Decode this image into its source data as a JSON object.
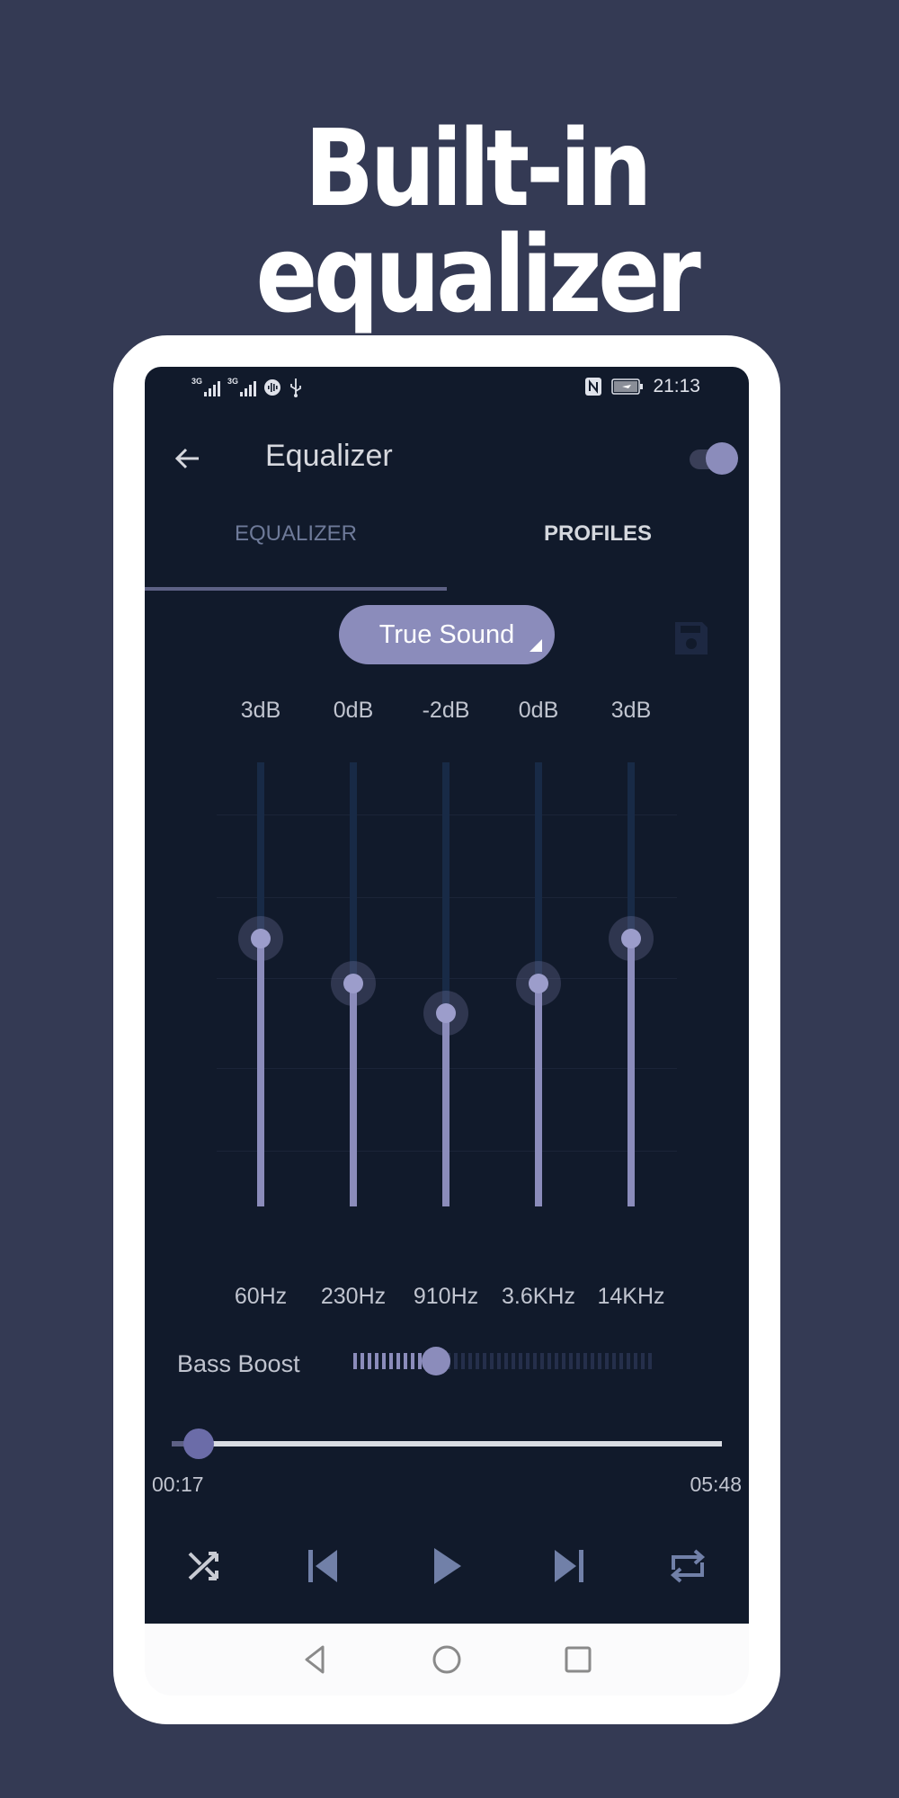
{
  "headline": "Built-in equalizer",
  "status_bar": {
    "network_1": "3G",
    "network_2": "3G",
    "time": "21:13",
    "icons": [
      "signal-icon",
      "signal-icon",
      "audio-icon",
      "usb-icon",
      "nfc-icon",
      "battery-charging-icon"
    ]
  },
  "app_bar": {
    "title": "Equalizer",
    "back_icon": "arrow-left-icon",
    "toggle_on": true
  },
  "tabs": [
    {
      "label": "EQUALIZER",
      "active": true
    },
    {
      "label": "PROFILES",
      "active": false
    }
  ],
  "preset": {
    "selected": "True Sound",
    "save_icon": "save-icon"
  },
  "equalizer": {
    "range_db": [
      -15,
      15
    ],
    "bands": [
      {
        "freq": "60Hz",
        "gain_label": "3dB",
        "gain": 3
      },
      {
        "freq": "230Hz",
        "gain_label": "0dB",
        "gain": 0
      },
      {
        "freq": "910Hz",
        "gain_label": "-2dB",
        "gain": -2
      },
      {
        "freq": "3.6KHz",
        "gain_label": "0dB",
        "gain": 0
      },
      {
        "freq": "14KHz",
        "gain_label": "3dB",
        "gain": 3
      }
    ]
  },
  "bass_boost": {
    "label": "Bass Boost",
    "level": 0.27
  },
  "playback": {
    "elapsed": "00:17",
    "duration": "05:48",
    "progress": 0.049,
    "controls": [
      "shuffle-icon",
      "skip-previous-icon",
      "play-icon",
      "skip-next-icon",
      "repeat-icon"
    ]
  },
  "nav_bar": [
    "back-icon",
    "home-icon",
    "recents-icon"
  ],
  "colors": {
    "background": "#343a54",
    "screen": "#111a2b",
    "accent": "#8b8cbb",
    "control": "#7180a8"
  }
}
